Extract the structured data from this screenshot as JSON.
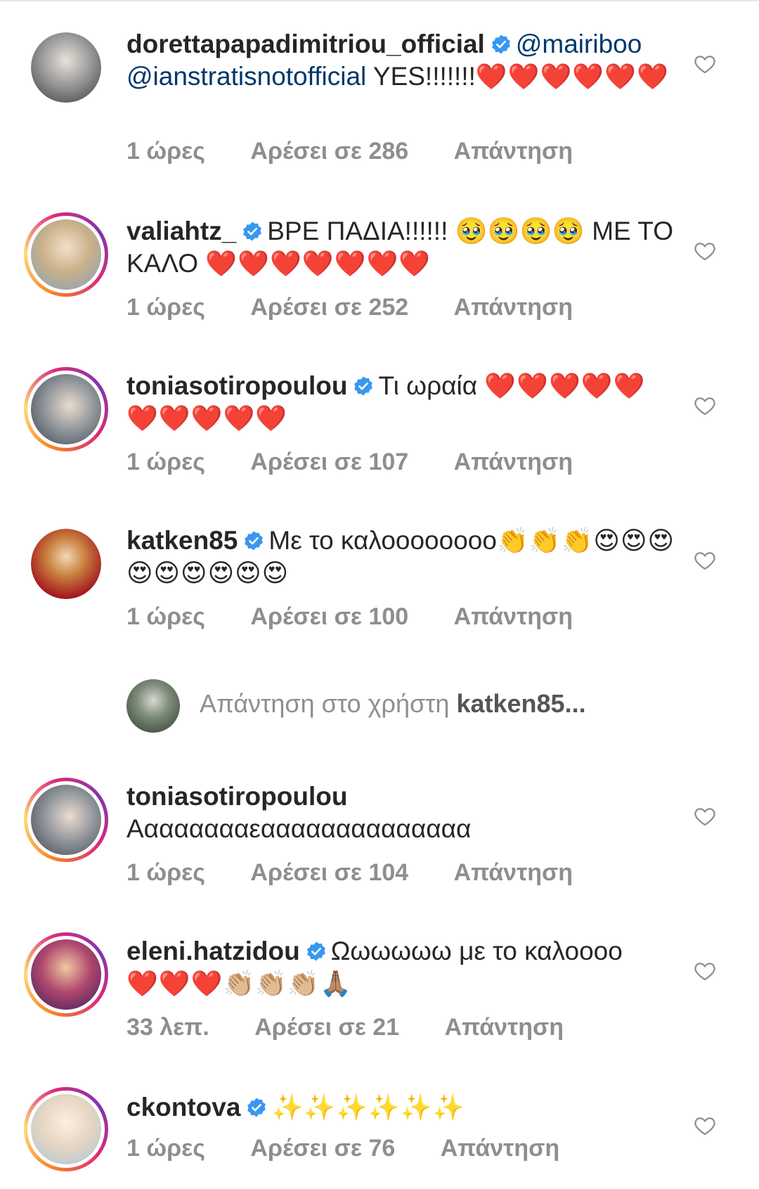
{
  "comments": [
    {
      "username": "dorettapapadimitriou_official",
      "verified": true,
      "mentions": [
        "@mairiboo",
        "@ianstratisnotofficial"
      ],
      "text": "YES!!!!!!!",
      "emoji": "❤️❤️❤️❤️❤️❤️",
      "time": "1 ώρες",
      "likes": "Αρέσει σε 286",
      "reply": "Απάντηση",
      "avatar_color": "#4a4a4a"
    },
    {
      "username": "valiahtz_",
      "verified": true,
      "text": "ΒΡΕ ΠΑΔΙΑ!!!!!! 🥹🥹🥹🥹 ΜΕ ΤΟ ΚΑΛΟ",
      "emoji": "❤️❤️❤️❤️❤️❤️❤️",
      "time": "1 ώρες",
      "likes": "Αρέσει σε 252",
      "reply": "Απάντηση",
      "avatar_color": "#c9b08a"
    },
    {
      "username": "toniasotiropoulou",
      "verified": true,
      "text": "Τι ωραία",
      "emoji": "❤️❤️❤️❤️❤️❤️❤️❤️❤️❤️",
      "time": "1 ώρες",
      "likes": "Αρέσει σε 107",
      "reply": "Απάντηση",
      "avatar_color": "#8a8f96"
    },
    {
      "username": "katken85",
      "verified": true,
      "text": "Με το καλοοοοοοοο",
      "emoji": "👏👏👏😍😍😍😍😍😍😍😍😍",
      "time": "1 ώρες",
      "likes": "Αρέσει σε 100",
      "reply": "Απάντηση",
      "avatar_color": "#a3151d"
    },
    {
      "username": "toniasotiropoulou",
      "verified": false,
      "text": "Ααααααααεαααααααααααααα",
      "emoji": "",
      "time": "1 ώρες",
      "likes": "Αρέσει σε 104",
      "reply": "Απάντηση",
      "avatar_color": "#8a8f96"
    },
    {
      "username": "eleni.hatzidou",
      "verified": true,
      "text": "Ωωωωωω με το καλοοοο",
      "emoji": "❤️❤️❤️👏🏼👏🏼👏🏼🙏🏽",
      "time": "33 λεπ.",
      "likes": "Αρέσει σε 21",
      "reply": "Απάντηση",
      "avatar_color": "#7a2a4d"
    },
    {
      "username": "ckontova",
      "verified": true,
      "text": "",
      "emoji": "✨✨✨✨✨✨",
      "time": "1 ώρες",
      "likes": "Αρέσει σε 76",
      "reply": "Απάντηση",
      "avatar_color": "#e6d6c2"
    }
  ],
  "reply_prompt": {
    "prefix": "Απάντηση στο χρήστη",
    "user": "katken85",
    "suffix": "..."
  },
  "colors": {
    "verified": "#3897f0",
    "muted": "#8e8e8e",
    "text": "#262626",
    "mention": "#00376b"
  }
}
